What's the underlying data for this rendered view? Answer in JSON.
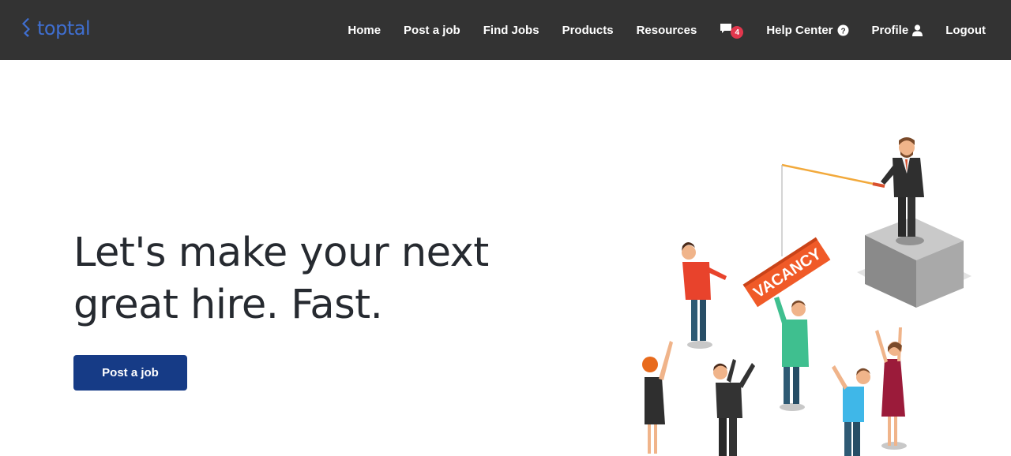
{
  "brand": {
    "name": "toptal",
    "color": "#3f6fd1"
  },
  "nav": {
    "home": "Home",
    "post_job": "Post a job",
    "find_jobs": "Find Jobs",
    "products": "Products",
    "resources": "Resources",
    "messages_count": "4",
    "help_center": "Help Center",
    "profile": "Profile",
    "logout": "Logout"
  },
  "hero": {
    "title_line1": "Let's make your next",
    "title_line2": "great hire. Fast.",
    "cta_label": "Post a job"
  },
  "illustration": {
    "sign_text": "VACANCY"
  },
  "colors": {
    "navbar": "#333333",
    "cta": "#163b86",
    "badge": "#e2374d"
  }
}
